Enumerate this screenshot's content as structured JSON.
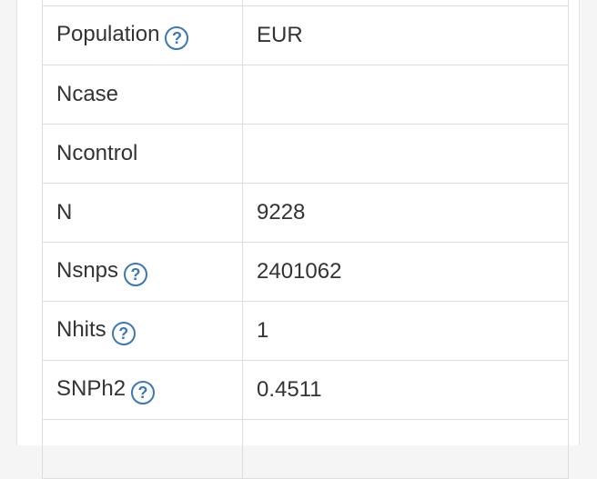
{
  "help_icon_glyph": "?",
  "colors": {
    "help_icon": "#3b78b5",
    "border": "#dddddd",
    "text": "#333333"
  },
  "rows": [
    {
      "label": "",
      "value": ""
    },
    {
      "label": "Population",
      "value": "EUR"
    },
    {
      "label": "Ncase",
      "value": ""
    },
    {
      "label": "Ncontrol",
      "value": ""
    },
    {
      "label": "N",
      "value": "9228"
    },
    {
      "label": "Nsnps",
      "value": "2401062"
    },
    {
      "label": "Nhits",
      "value": "1"
    },
    {
      "label": "SNPh2",
      "value": "0.4511"
    },
    {
      "label": "",
      "value": ""
    }
  ]
}
